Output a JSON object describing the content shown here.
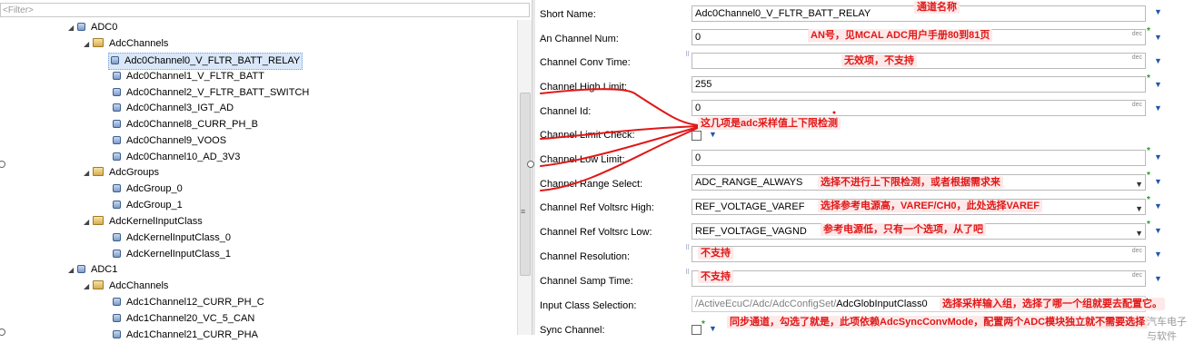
{
  "tree": {
    "filter_placeholder": "<Filter>",
    "nodes": [
      {
        "label": "ADC0",
        "type": "module",
        "expanded": true
      },
      {
        "label": "AdcChannels",
        "type": "folder",
        "expanded": true
      },
      {
        "label": "Adc0Channel0_V_FLTR_BATT_RELAY",
        "type": "item",
        "selected": true
      },
      {
        "label": "Adc0Channel1_V_FLTR_BATT",
        "type": "item"
      },
      {
        "label": "Adc0Channel2_V_FLTR_BATT_SWITCH",
        "type": "item"
      },
      {
        "label": "Adc0Channel3_IGT_AD",
        "type": "item"
      },
      {
        "label": "Adc0Channel8_CURR_PH_B",
        "type": "item"
      },
      {
        "label": "Adc0Channel9_VOOS",
        "type": "item"
      },
      {
        "label": "Adc0Channel10_AD_3V3",
        "type": "item"
      },
      {
        "label": "AdcGroups",
        "type": "folder",
        "expanded": true
      },
      {
        "label": "AdcGroup_0",
        "type": "item"
      },
      {
        "label": "AdcGroup_1",
        "type": "item"
      },
      {
        "label": "AdcKernelInputClass",
        "type": "folder",
        "expanded": true
      },
      {
        "label": "AdcKernelInputClass_0",
        "type": "item"
      },
      {
        "label": "AdcKernelInputClass_1",
        "type": "item"
      },
      {
        "label": "ADC1",
        "type": "module",
        "expanded": true
      },
      {
        "label": "AdcChannels",
        "type": "folder",
        "expanded": true
      },
      {
        "label": "Adc1Channel12_CURR_PH_C",
        "type": "item"
      },
      {
        "label": "Adc1Channel20_VC_5_CAN",
        "type": "item"
      },
      {
        "label": "Adc1Channel21_CURR_PHA",
        "type": "item"
      }
    ]
  },
  "props": {
    "short_name": {
      "label": "Short Name:",
      "value": "Adc0Channel0_V_FLTR_BATT_RELAY"
    },
    "an_channel_num": {
      "label": "An Channel Num:",
      "value": "0",
      "unit": "dec"
    },
    "conv_time": {
      "label": "Channel Conv Time:",
      "value": "",
      "unit": "dec"
    },
    "high_limit": {
      "label": "Channel High Limit:",
      "value": "255"
    },
    "channel_id": {
      "label": "Channel Id:",
      "value": "0",
      "unit": "dec"
    },
    "limit_check": {
      "label": "Channel Limit Check:"
    },
    "low_limit": {
      "label": "Channel Low Limit:",
      "value": "0"
    },
    "range_select": {
      "label": "Channel Range Select:",
      "value": "ADC_RANGE_ALWAYS"
    },
    "ref_high": {
      "label": "Channel Ref Voltsrc High:",
      "value": "REF_VOLTAGE_VAREF"
    },
    "ref_low": {
      "label": "Channel Ref Voltsrc Low:",
      "value": "REF_VOLTAGE_VAGND"
    },
    "resolution": {
      "label": "Channel Resolution:",
      "value": "",
      "unit": "dec"
    },
    "samp_time": {
      "label": "Channel Samp Time:",
      "value": "",
      "unit": "dec"
    },
    "input_class": {
      "label": "Input Class Selection:",
      "path_prefix": "/ActiveEcuC/Adc/AdcConfigSet/",
      "path_value": "AdcGlobInputClass0"
    },
    "sync_channel": {
      "label": "Sync Channel:"
    }
  },
  "annotations": {
    "short_name": "通道名称",
    "an_num": "AN号，见MCAL ADC用户手册80到81页",
    "conv_time": "无效项，不支持",
    "limits": "这几项是adc采样值上下限检测",
    "range_select": "选择不进行上下限检测，或者根据需求来",
    "ref_high": "选择参考电源高，VAREF/CH0，此处选择VAREF",
    "ref_low": "参考电源低，只有一个选项，从了吧",
    "resolution": "不支持",
    "samp_time": "不支持",
    "input_class": "选择采样输入组，选择了哪一个组就要去配置它。",
    "sync": "同步通道，勾选了就是，此项依赖AdcSyncConvMode，配置两个ADC模块独立就不需要选择"
  },
  "watermark": "汽车电子与软件",
  "colors": {
    "annotation_red": "#e01818",
    "annotation_bg": "#fde9e9",
    "selection": "#d9e7f8",
    "star_green": "#2a9a2a"
  }
}
